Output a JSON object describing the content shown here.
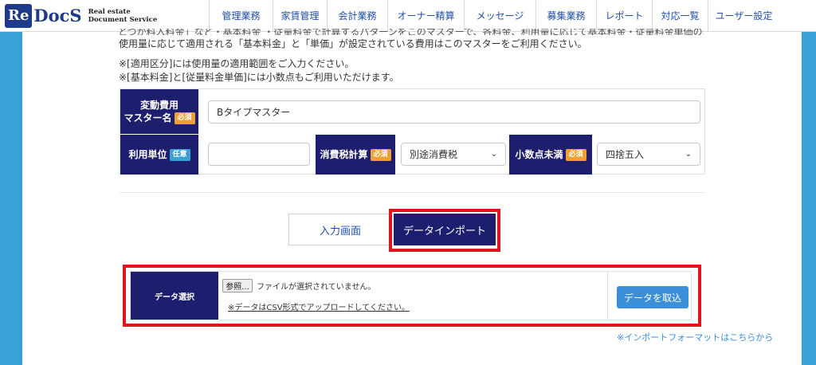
{
  "header": {
    "logo_re": "Re",
    "logo_docs": "DocS",
    "logo_tag_line1": "Real estate",
    "logo_tag_line2": "Document Service",
    "nav": [
      "管理業務",
      "家賃管理",
      "会計業務",
      "オーナー精算",
      "メッセージ",
      "募集業務",
      "レポート",
      "対応一覧",
      "ユーザー設定"
    ]
  },
  "intro": {
    "truncated_line": "とつか料入料金」など・基本料金 ・従量料金で計算するパターンをこのマスターで、各料金、利用量に応じて基本料金・従量料金単価の変動のパターン",
    "line1": "使用量に応じて適用される「基本料金」と「単価」が設定されている費用はこのマスターをご利用ください。",
    "note1": "※[適用区分]には使用量の適用範囲をご入力ください。",
    "note2": "※[基本料金]と[従量料金単価]には小数点もご利用いただけます。"
  },
  "form": {
    "master_name_label_1": "変動費用",
    "master_name_label_2": "マスター名",
    "required": "必須",
    "optional": "任意",
    "master_name_value": "Bタイプマスター",
    "unit_label": "利用単位",
    "unit_value": "",
    "tax_label": "消費税計算",
    "tax_value": "別途消費税",
    "decimal_label": "小数点未満",
    "decimal_value": "四捨五入"
  },
  "tabs": {
    "input_screen": "入力画面",
    "data_import": "データインポート"
  },
  "import": {
    "label": "データ選択",
    "browse": "参照...",
    "no_file": "ファイルが選択されていません。",
    "csv_note": "※データはCSV形式でアップロードしてください。",
    "import_button": "データを取込",
    "format_link": "※インポートフォーマットはこちらから"
  },
  "colors": {
    "accent_navy": "#1e1e6e",
    "header_blue": "#1f4fa8",
    "background_blue": "#3aa0d8",
    "required_orange": "#f0a030",
    "highlight_red": "#e0141e",
    "button_blue": "#3a8fd8"
  }
}
